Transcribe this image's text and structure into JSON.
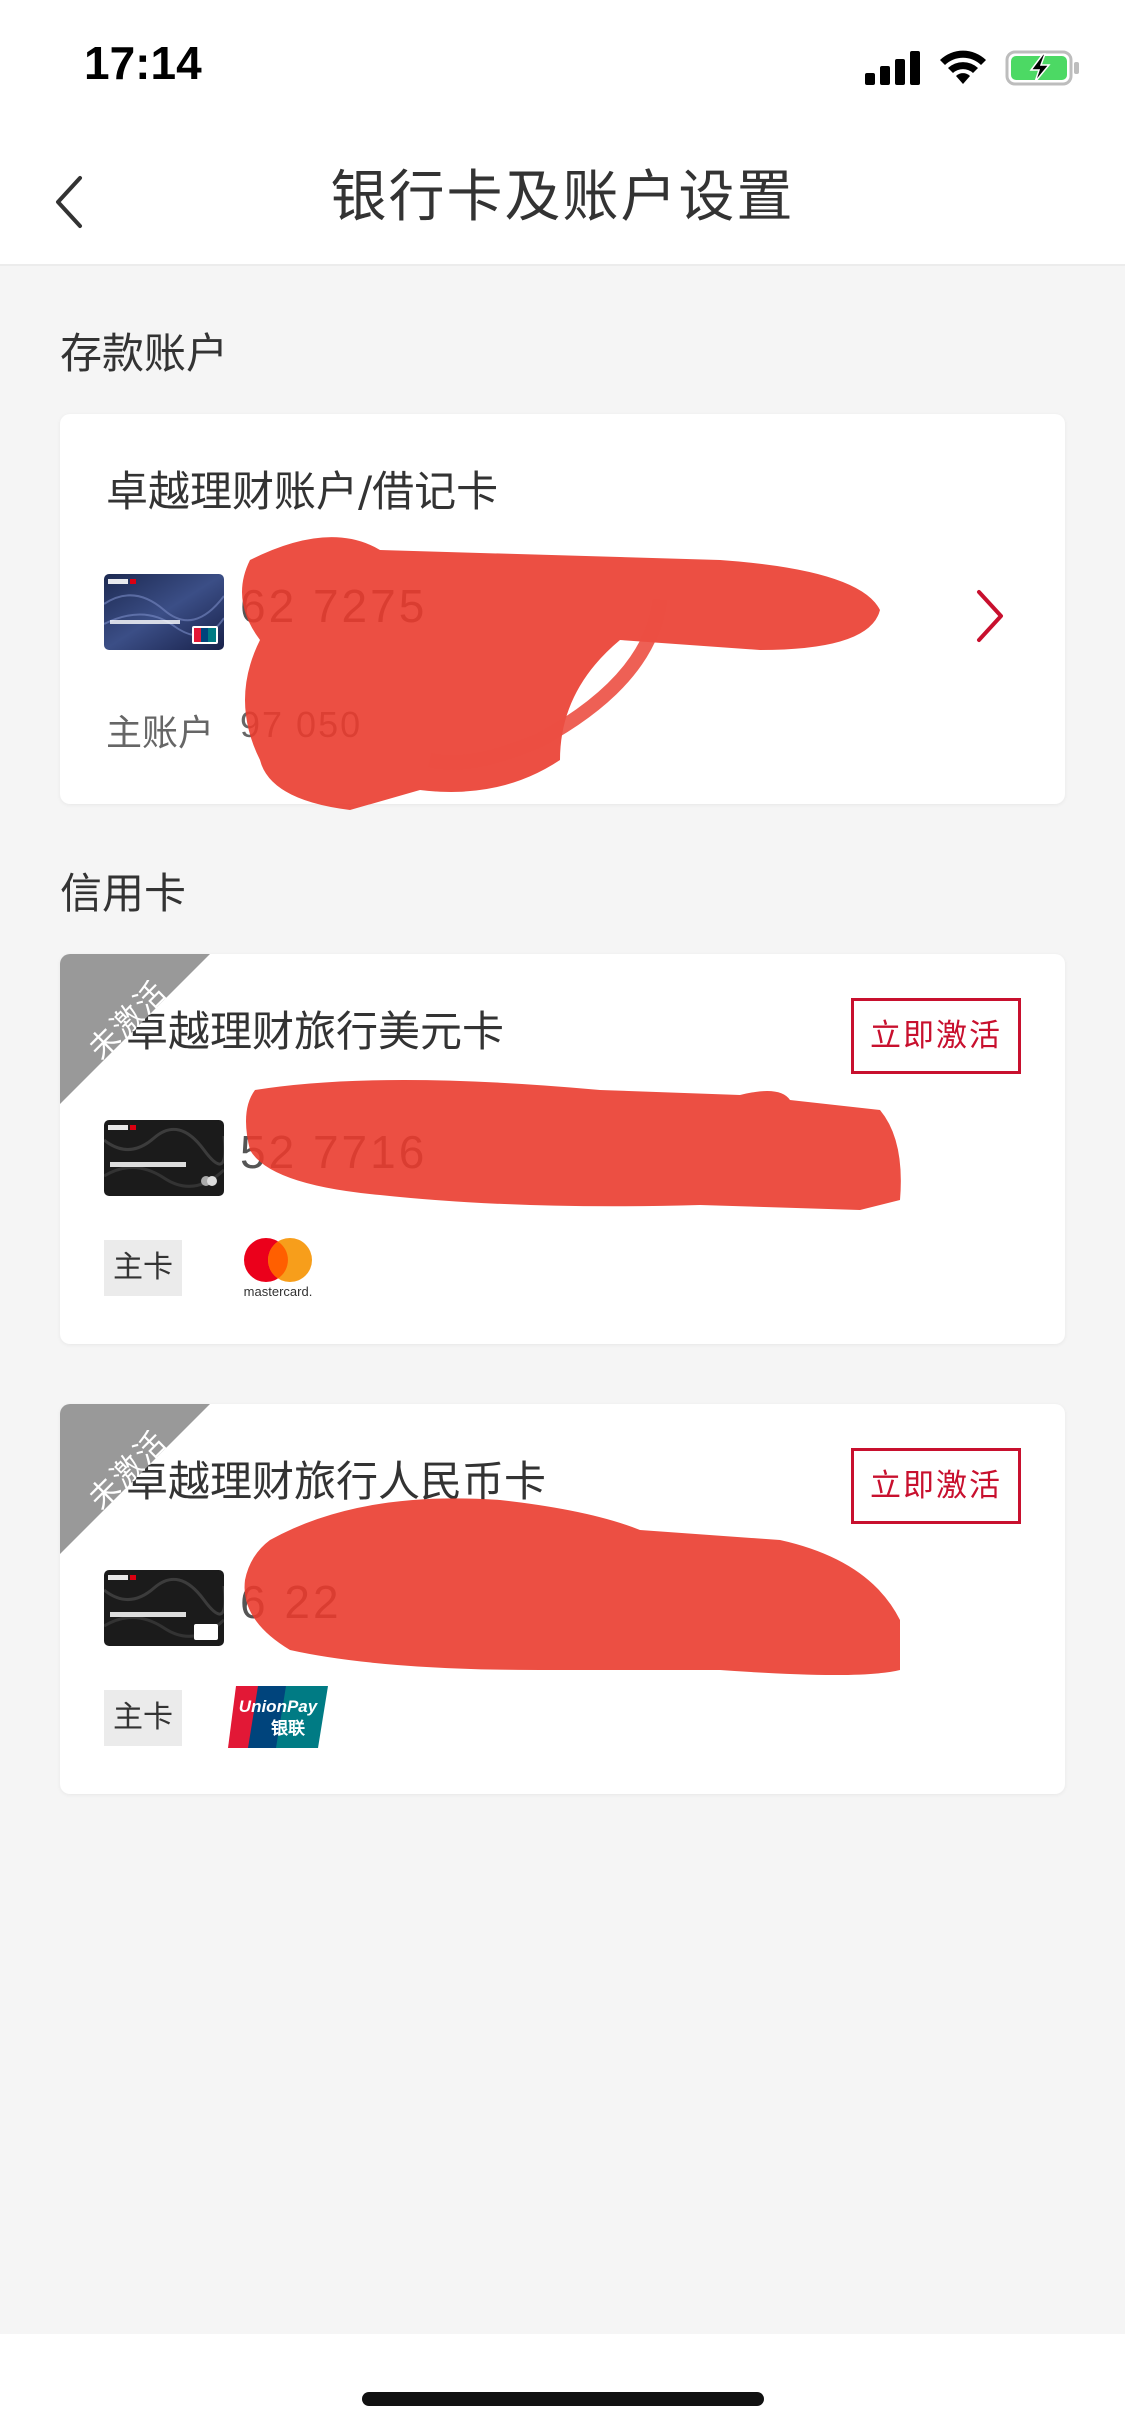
{
  "status_bar": {
    "time": "17:14"
  },
  "nav": {
    "title": "银行卡及账户设置"
  },
  "sections": {
    "deposit": "存款账户",
    "credit": "信用卡"
  },
  "deposit_card": {
    "title": "卓越理财账户/借记卡",
    "number_visible": "62                                  7275",
    "sub_label": "主账户",
    "sub_value": "97                    050"
  },
  "credit_cards": [
    {
      "title": "卓越理财旅行美元卡",
      "status": "未激活",
      "action": "立即激活",
      "number_visible": "52                                  7716",
      "tag": "主卡",
      "brand": "mastercard"
    },
    {
      "title": "卓越理财旅行人民币卡",
      "status": "未激活",
      "action": "立即激活",
      "number_visible": "6                                    22",
      "tag": "主卡",
      "brand": "UnionPay 银联"
    }
  ],
  "colors": {
    "accent": "#c8102e",
    "redaction": "#ea3b2e",
    "background": "#f5f5f5"
  }
}
